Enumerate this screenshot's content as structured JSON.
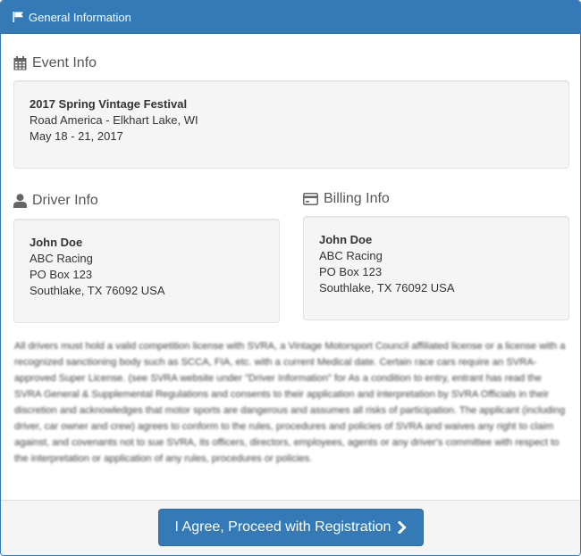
{
  "panel": {
    "title": "General Information",
    "icon": "flag-icon"
  },
  "event": {
    "section_title": "Event Info",
    "icon": "calendar-icon",
    "name": "2017 Spring Vintage Festival",
    "venue": "Road America - Elkhart Lake, WI",
    "dates": "May 18 - 21, 2017"
  },
  "driver": {
    "section_title": "Driver Info",
    "icon": "user-icon",
    "name": "John Doe",
    "team": "ABC Racing",
    "address1": "PO Box 123",
    "address2": "Southlake, TX 76092 USA"
  },
  "billing": {
    "section_title": "Billing Info",
    "icon": "credit-card-icon",
    "name": "John Doe",
    "team": "ABC Racing",
    "address1": "PO Box 123",
    "address2": "Southlake, TX 76092 USA"
  },
  "disclaimer": {
    "text": "All drivers must hold a valid competition license with SVRA, a Vintage Motorsport Council affiliated license or a license with a recognized sanctioning body such as SCCA, FIA, etc. with a current Medical date. Certain race cars require an SVRA-approved Super License. (see SVRA website under \"Driver Information\" for As a condition to entry, entrant has read the SVRA General & Supplemental Regulations and consents to their application and interpretation by SVRA Officials in their discretion and acknowledges that motor sports are dangerous and assumes all risks of participation. The applicant (including driver, car owner and crew) agrees to conform to the rules, procedures and policies of SVRA and waives any right to claim against, and covenants not to sue SVRA, its officers, directors, employees, agents or any driver's committee with respect to the interpretation or application of any rules, procedures or policies."
  },
  "footer": {
    "agree_label": "I Agree, Proceed with Registration",
    "agree_icon": "chevron-right-icon"
  },
  "colors": {
    "primary": "#337ab7",
    "well_bg": "#f5f5f5"
  }
}
